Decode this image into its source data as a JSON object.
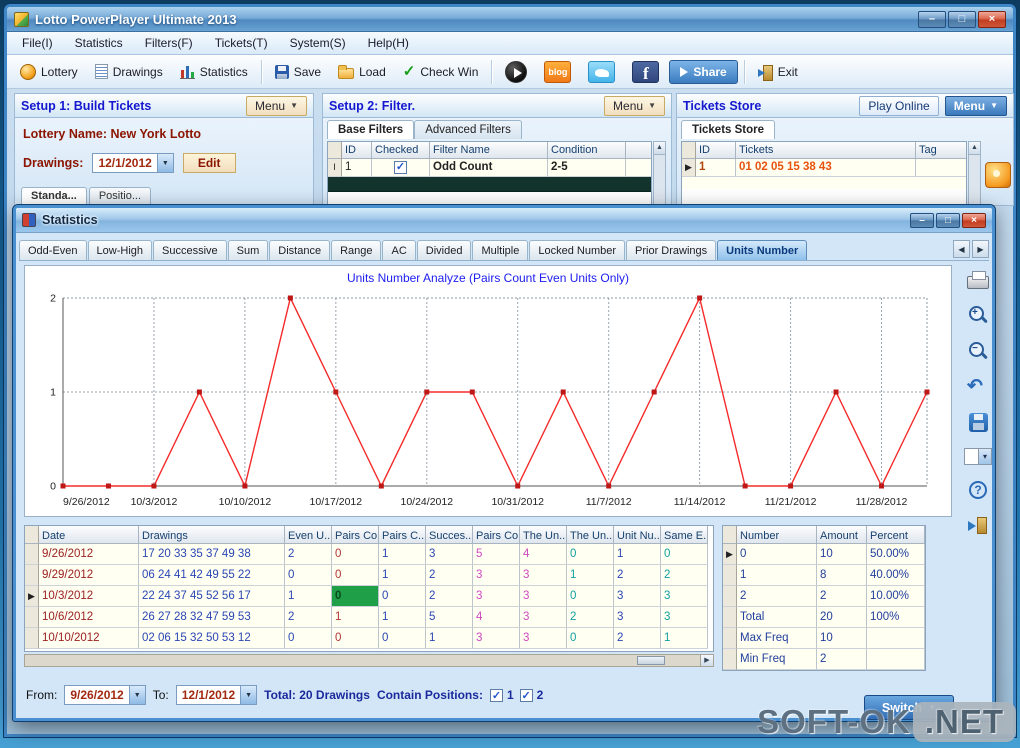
{
  "desktop": {
    "watermark_left": "SOFT-OK",
    "watermark_right": ".NET"
  },
  "window": {
    "title": "Lotto PowerPlayer Ultimate 2013",
    "menu": [
      "File(I)",
      "Statistics",
      "Filters(F)",
      "Tickets(T)",
      "System(S)",
      "Help(H)"
    ],
    "toolbar": [
      {
        "label": "Lottery",
        "icon": "lottery-icon"
      },
      {
        "label": "Drawings",
        "icon": "drawings-icon"
      },
      {
        "label": "Statistics",
        "icon": "statistics-icon"
      },
      {
        "label": "Save",
        "icon": "save-icon"
      },
      {
        "label": "Load",
        "icon": "load-icon"
      },
      {
        "label": "Check Win",
        "icon": "check-icon"
      },
      {
        "label": "",
        "icon": "play-icon"
      },
      {
        "label": "blog",
        "icon": "blog-icon"
      },
      {
        "label": "",
        "icon": "twitter-icon"
      },
      {
        "label": "",
        "icon": "facebook-icon"
      },
      {
        "label": "Share",
        "icon": "share-icon"
      },
      {
        "label": "Exit",
        "icon": "exit-icon"
      }
    ]
  },
  "setup1": {
    "header": "Setup 1: Build  Tickets",
    "menu_button": "Menu",
    "lottery_label": "Lottery  Name:",
    "lottery_name": "New York Lotto",
    "drawings_label": "Drawings:",
    "drawings_value": "12/1/2012",
    "edit_button": "Edit",
    "tabs": [
      "Standa...",
      "Positio..."
    ]
  },
  "setup2": {
    "header": "Setup 2: Filter.",
    "menu_button": "Menu",
    "tabs": [
      "Base Filters",
      "Advanced Filters"
    ],
    "active_tab": "Base Filters",
    "grid": {
      "columns": [
        "ID",
        "Checked",
        "Filter Name",
        "Condition"
      ],
      "rows": [
        {
          "id": "1",
          "checked": true,
          "name": "Odd Count",
          "condition": "2-5"
        }
      ]
    }
  },
  "tickets_store": {
    "header": "Tickets Store",
    "play_online_button": "Play Online",
    "menu_button": "Menu",
    "tab": "Tickets Store",
    "grid": {
      "columns": [
        "ID",
        "Tickets",
        "Tag"
      ],
      "rows": [
        {
          "id": "1",
          "tickets": "01 02 05 15 38 43",
          "tag": ""
        }
      ]
    }
  },
  "stats": {
    "title": "Statistics",
    "tabs": [
      "Odd-Even",
      "Low-High",
      "Successive",
      "Sum",
      "Distance",
      "Range",
      "AC",
      "Divided",
      "Multiple",
      "Locked Number",
      "Prior Drawings",
      "Units Number"
    ],
    "active_tab": "Units Number",
    "left_grid": {
      "columns": [
        "Date",
        "Drawings",
        "Even U...",
        "Pairs Co",
        "Pairs C...",
        "Succes...",
        "Pairs Co",
        "The Un...",
        "The Un...",
        "Unit Nu...",
        "Same E..."
      ],
      "column_colors": [
        "#9c2020",
        "#2a46b4",
        "#2a46b4",
        "#b03434",
        "#2a46b4",
        "#2a46b4",
        "#d048c0",
        "#d048c0",
        "#12a0a0",
        "#2a46b4",
        "#12a0a0"
      ],
      "rows": [
        [
          "9/26/2012",
          "17 20 33 35 37 49 38",
          "2",
          "0",
          "1",
          "3",
          "5",
          "4",
          "0",
          "1",
          "0"
        ],
        [
          "9/29/2012",
          "06 24 41 42 49 55 22",
          "0",
          "0",
          "1",
          "2",
          "3",
          "3",
          "1",
          "2",
          "2"
        ],
        [
          "10/3/2012",
          "22 24 37 45 52 56 17",
          "1",
          "0",
          "0",
          "2",
          "3",
          "3",
          "0",
          "3",
          "3"
        ],
        [
          "10/6/2012",
          "26 27 28 32 47 59 53",
          "2",
          "1",
          "1",
          "5",
          "4",
          "3",
          "2",
          "3",
          "3"
        ],
        [
          "10/10/2012",
          "02 06 15 32 50 53 12",
          "0",
          "0",
          "0",
          "1",
          "3",
          "3",
          "0",
          "2",
          "1"
        ]
      ],
      "current_row": 2,
      "selected_cell": {
        "row": 2,
        "col": 3
      }
    },
    "right_grid": {
      "columns": [
        "Number",
        "Amount",
        "Percent"
      ],
      "rows": [
        [
          "0",
          "10",
          "50.00%"
        ],
        [
          "1",
          "8",
          "40.00%"
        ],
        [
          "2",
          "2",
          "10.00%"
        ],
        [
          "Total",
          "20",
          "100%"
        ],
        [
          "Max Freq",
          "10",
          ""
        ],
        [
          "Min Freq",
          "2",
          ""
        ]
      ],
      "current_row": 0
    },
    "footer": {
      "from_label": "From:",
      "from_value": "9/26/2012",
      "to_label": "To:",
      "to_value": "12/1/2012",
      "total_text": "Total: 20 Drawings",
      "contain_label": "Contain Positions:",
      "positions": [
        {
          "label": "1",
          "checked": true
        },
        {
          "label": "2",
          "checked": true
        }
      ],
      "switch_button": "Switch"
    }
  },
  "chart_data": {
    "type": "line",
    "title": "Units Number Analyze (Pairs Count Even Units Only)",
    "x": [
      "9/26/2012",
      "9/29/2012",
      "10/3/2012",
      "10/6/2012",
      "10/10/2012",
      "10/13/2012",
      "10/17/2012",
      "10/20/2012",
      "10/24/2012",
      "10/27/2012",
      "10/31/2012",
      "11/3/2012",
      "11/7/2012",
      "11/10/2012",
      "11/14/2012",
      "11/17/2012",
      "11/21/2012",
      "11/24/2012",
      "11/28/2012",
      "12/1/2012"
    ],
    "values": [
      0,
      0,
      0,
      1,
      0,
      2,
      1,
      0,
      1,
      1,
      0,
      1,
      0,
      1,
      2,
      0,
      0,
      1,
      0,
      1
    ],
    "x_tick_labels": [
      "9/26/2012",
      "10/3/2012",
      "10/10/2012",
      "10/17/2012",
      "10/24/2012",
      "10/31/2012",
      "11/7/2012",
      "11/14/2012",
      "11/21/2012",
      "11/28/2012"
    ],
    "y_ticks": [
      0,
      1,
      2
    ],
    "ylim": [
      0,
      2
    ],
    "line_color": "#f52a2a",
    "marker_color": "#bf1616",
    "grid": "dotted",
    "legend": "none"
  }
}
